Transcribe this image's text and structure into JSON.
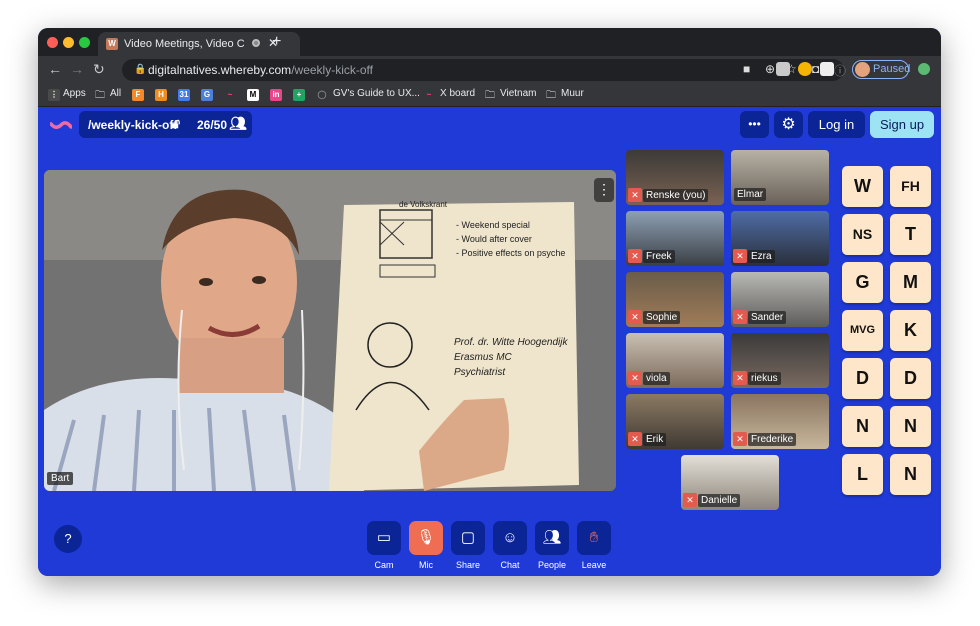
{
  "browser": {
    "tab_title": "Video Meetings, Video Con",
    "tab_favicon": "W",
    "new_tab": "+",
    "url_host": "digitalnatives.whereby.com",
    "url_path": "/weekly-kick-off",
    "profile_status": "Paused",
    "bookmarks": [
      "Apps",
      "All",
      "GV's Guide to UX...",
      "X board",
      "Vietnam",
      "Muur"
    ]
  },
  "room": {
    "name": "/weekly-kick-off",
    "count": "26/50",
    "menu_label": "•••",
    "login": "Log in",
    "signup": "Sign up"
  },
  "main_video": {
    "name": "Bart",
    "card_lines": [
      "- Weekend special",
      "- Would after cover",
      "- Positive effects on psyche",
      "Prof. dr. Witte Hoogendijk",
      "Erasmus MC",
      "Psychiatrist"
    ],
    "card_heading": "de Volkskrant"
  },
  "participants": [
    "Renske (you)",
    "Elmar",
    "Freek",
    "Ezra",
    "Sophie",
    "Sander",
    "viola",
    "riekus",
    "Erik",
    "Frederike",
    "Danielle"
  ],
  "tiles": [
    "W",
    "FH",
    "NS",
    "T",
    "G",
    "M",
    "MVG",
    "K",
    "D",
    "D",
    "N",
    "N",
    "L",
    "N"
  ],
  "controls": [
    "Cam",
    "Mic",
    "Share",
    "Chat",
    "People",
    "Leave"
  ],
  "help": "?",
  "colors": {
    "background": "#1f3ad7",
    "panel": "#0b2496",
    "tile": "#fde6c9",
    "mic_muted": "#ef6d52",
    "signup": "#9de3f4"
  }
}
